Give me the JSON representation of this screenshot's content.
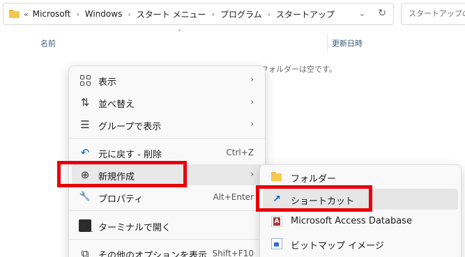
{
  "address_bar": {
    "overflow": "«",
    "crumbs": [
      "Microsoft",
      "Windows",
      "スタート メニュー",
      "プログラム",
      "スタートアップ"
    ],
    "separator": "›",
    "dropdown_glyph": "⌄",
    "refresh_glyph": "↻"
  },
  "search": {
    "placeholder": "スタートアップの検索"
  },
  "columns": {
    "name": "名前",
    "date": "更新日時",
    "sort_glyph": "˄"
  },
  "empty_message": "このフォルダーは空です。",
  "context_menu": {
    "items": [
      {
        "icon": "view-grid-icon",
        "label": "表示",
        "arrow": "›"
      },
      {
        "icon": "sort-icon",
        "label": "並べ替え",
        "arrow": "›",
        "icon_glyph": "⇅"
      },
      {
        "icon": "group-list-icon",
        "label": "グループで表示",
        "arrow": "›",
        "icon_glyph": "☰"
      },
      {
        "icon": "undo-icon",
        "label": "元に戻す - 削除",
        "shortcut": "Ctrl+Z",
        "icon_glyph": "↶"
      },
      {
        "icon": "add-circle-icon",
        "label": "新規作成",
        "arrow": "›",
        "icon_glyph": "⊕"
      },
      {
        "icon": "wrench-icon",
        "label": "プロパティ",
        "shortcut": "Alt+Enter",
        "icon_glyph": "🔧"
      },
      {
        "icon": "terminal-icon",
        "label": "ターミナルで開く",
        "icon_glyph": ">_"
      },
      {
        "icon": "more-options-icon",
        "label": "その他のオプションを表示",
        "shortcut": "Shift+F10",
        "icon_glyph": "⧉"
      }
    ]
  },
  "new_submenu": {
    "items": [
      {
        "icon": "folder-icon",
        "label": "フォルダー"
      },
      {
        "icon": "shortcut-arrow-icon",
        "label": "ショートカット",
        "icon_glyph": "↗"
      },
      {
        "icon": "access-database-icon",
        "label": "Microsoft Access Database"
      },
      {
        "icon": "bitmap-image-icon",
        "label": "ビットマップ イメージ"
      }
    ]
  },
  "colors": {
    "highlight_box": "#e8000b",
    "accent": "#0067c0"
  }
}
